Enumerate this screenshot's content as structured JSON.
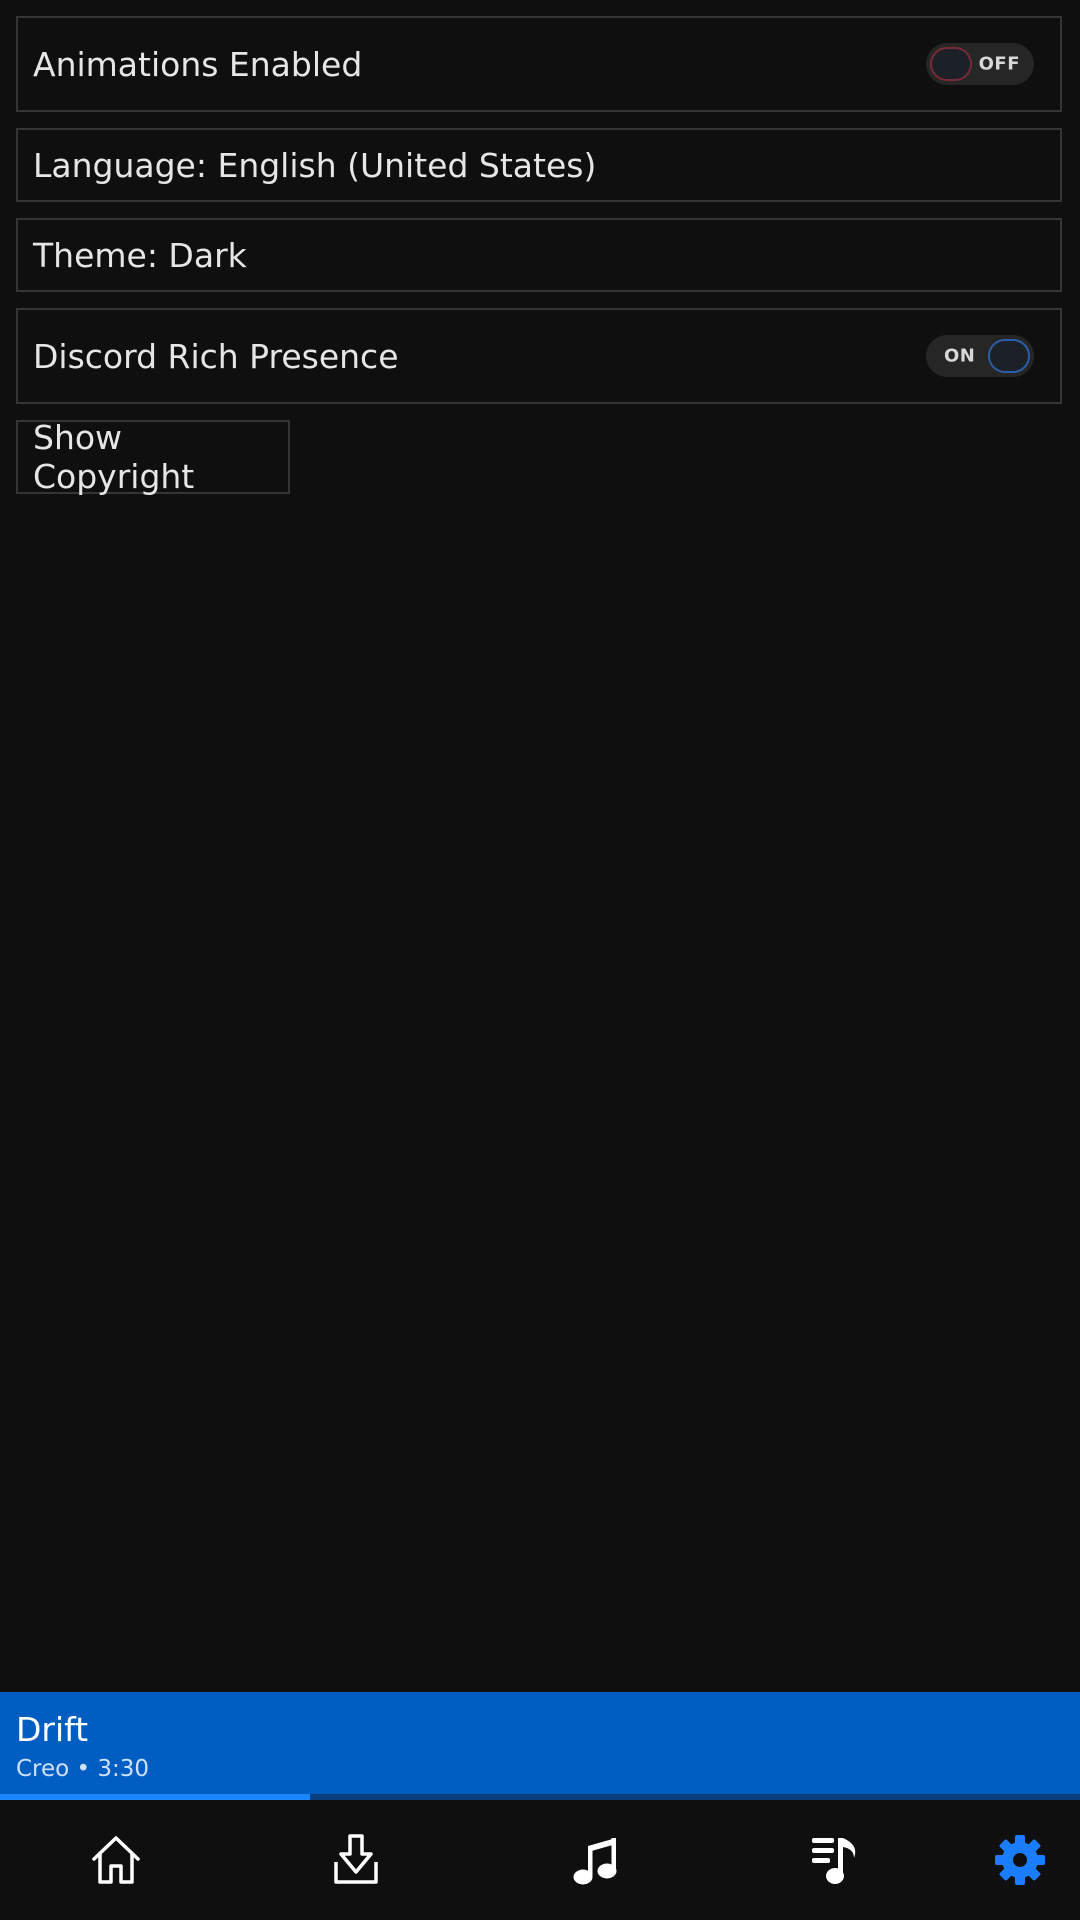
{
  "settings": {
    "animations": {
      "label": "Animations Enabled",
      "toggle_text": "OFF",
      "enabled": false
    },
    "language": {
      "label": "Language: English (United States)"
    },
    "theme": {
      "label": "Theme: Dark"
    },
    "discord": {
      "label": "Discord Rich Presence",
      "toggle_text": "ON",
      "enabled": true
    },
    "copyright": {
      "label": "Show Copyright"
    }
  },
  "now_playing": {
    "title": "Drift",
    "subtitle": "Creo • 3:30",
    "progress": 0.287
  },
  "nav": [
    {
      "id": "home",
      "icon": "home-icon",
      "active": false
    },
    {
      "id": "download",
      "icon": "download-icon",
      "active": false
    },
    {
      "id": "music",
      "icon": "music-note-icon",
      "active": false
    },
    {
      "id": "queue",
      "icon": "queue-music-icon",
      "active": false
    },
    {
      "id": "settings",
      "icon": "gear-icon",
      "active": true
    }
  ],
  "colors": {
    "background": "#0f0f0f",
    "border": "#353535",
    "accent": "#005ec2",
    "progress": "#1a86ff",
    "active_icon": "#1a7cff",
    "off_knob_border": "#7a2a36",
    "on_knob_border": "#2a5fa8"
  }
}
